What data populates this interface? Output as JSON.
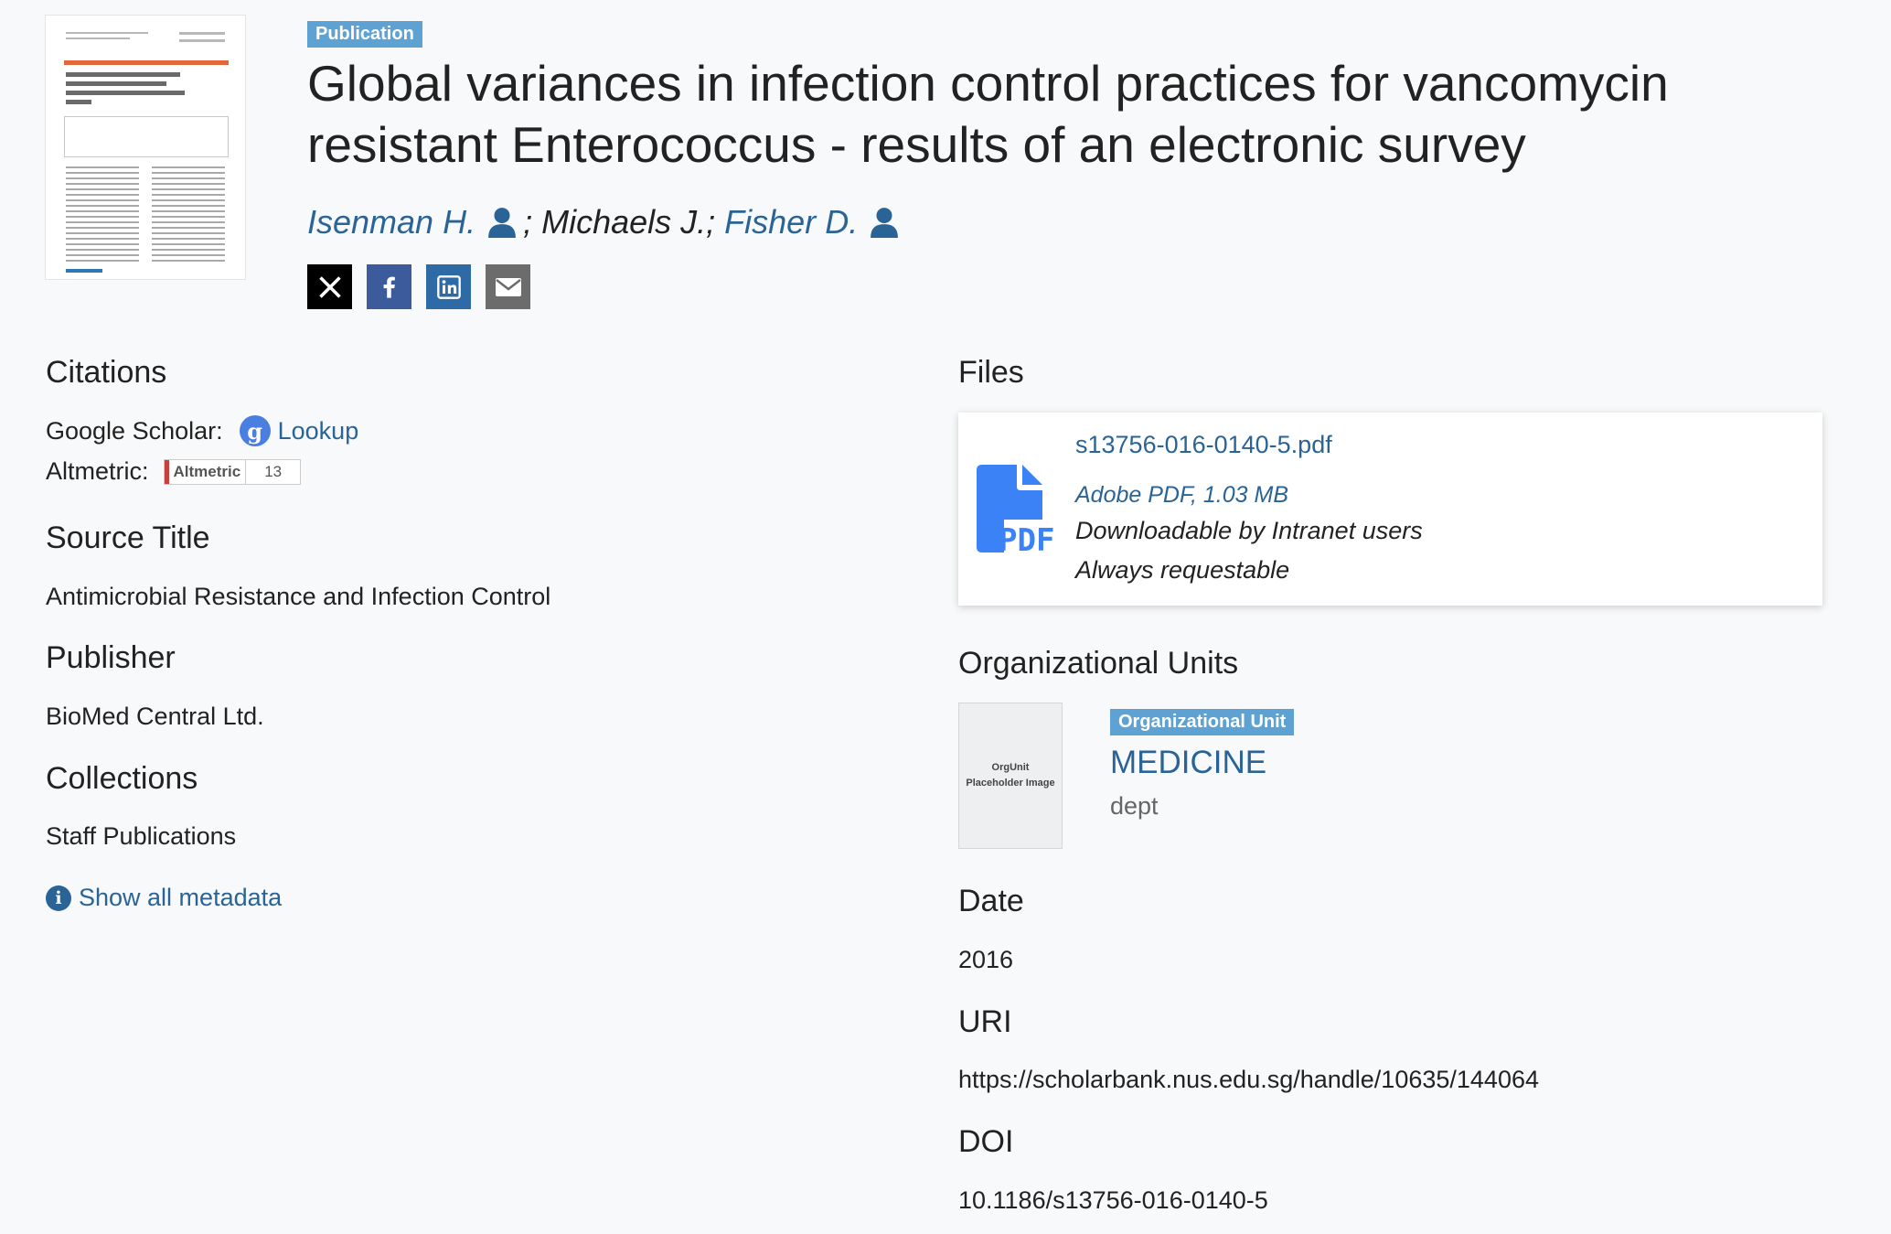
{
  "item": {
    "type_badge": "Publication",
    "title": "Global variances in infection control practices for vancomycin resistant Enterococcus - results of an electronic survey",
    "authors": [
      {
        "name": "Isenman H.",
        "linked": true
      },
      {
        "name": "Michaels J.",
        "linked": false
      },
      {
        "name": "Fisher D.",
        "linked": true
      }
    ],
    "author_separator": "; ",
    "thumbnail_icon": "document-thumbnail"
  },
  "share": {
    "x_icon": "x-icon",
    "facebook_icon": "facebook-icon",
    "linkedin_icon": "linkedin-icon",
    "email_icon": "email-icon"
  },
  "citations": {
    "heading": "Citations",
    "google_scholar_label": "Google Scholar:",
    "google_scholar_link": "Lookup",
    "altmetric_label": "Altmetric:",
    "altmetric_badge_text": "Altmetric",
    "altmetric_score": "13"
  },
  "source_title": {
    "heading": "Source Title",
    "value": "Antimicrobial Resistance and Infection Control"
  },
  "publisher": {
    "heading": "Publisher",
    "value": "BioMed Central Ltd."
  },
  "collections": {
    "heading": "Collections",
    "items": [
      "Staff Publications"
    ]
  },
  "show_metadata": "Show all metadata",
  "files": {
    "heading": "Files",
    "items": [
      {
        "name": "s13756-016-0140-5.pdf",
        "format": "Adobe PDF, 1.03 MB",
        "access": "Downloadable by Intranet users",
        "request": "Always requestable",
        "icon_label": "PDF"
      }
    ]
  },
  "org_units": {
    "heading": "Organizational Units",
    "placeholder_line1": "OrgUnit",
    "placeholder_line2": "Placeholder Image",
    "badge": "Organizational Unit",
    "name": "MEDICINE",
    "type": "dept"
  },
  "date": {
    "heading": "Date",
    "value": "2016"
  },
  "uri": {
    "heading": "URI",
    "value": "https://scholarbank.nus.edu.sg/handle/10635/144064"
  },
  "doi": {
    "heading": "DOI",
    "value": "10.1186/s13756-016-0140-5"
  },
  "colors": {
    "link": "#2a6496",
    "badge": "#5ea2d4",
    "background": "#f8f9fa"
  }
}
